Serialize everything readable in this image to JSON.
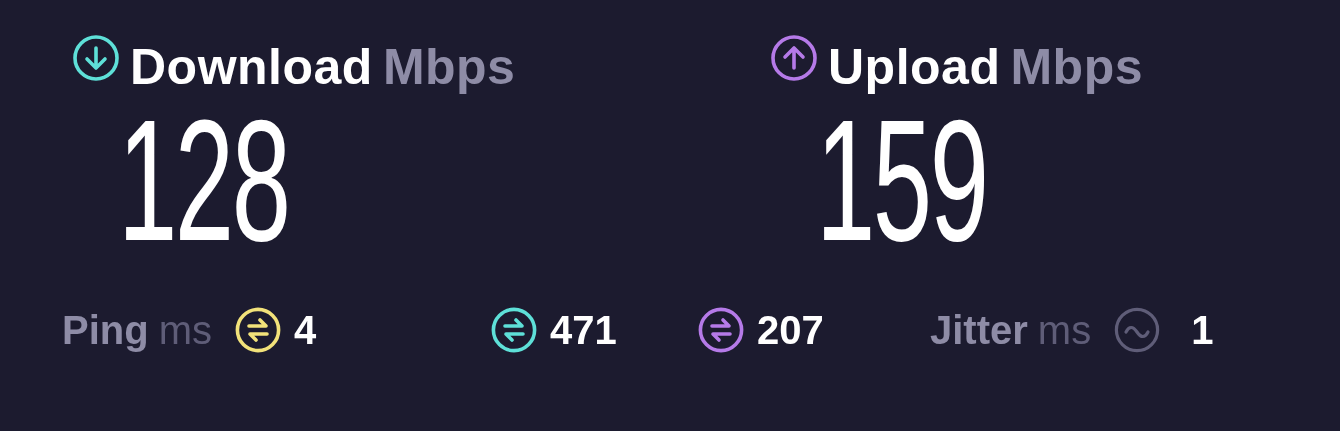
{
  "speeds": [
    {
      "kind": "download",
      "label": "Download",
      "unit": "Mbps",
      "value": "128",
      "color": "#5ee0d8"
    },
    {
      "kind": "upload",
      "label": "Upload",
      "unit": "Mbps",
      "value": "159",
      "color": "#b57ae8"
    }
  ],
  "stats": [
    {
      "kind": "ping",
      "label": "Ping",
      "unit": "ms",
      "color": "#f2e27a",
      "value": "4"
    },
    {
      "kind": "latency",
      "color": "#5ee0d8",
      "value": "471"
    },
    {
      "kind": "latency",
      "color": "#b57ae8",
      "value": "207"
    },
    {
      "kind": "jitter",
      "label": "Jitter",
      "unit": "ms",
      "value": "1"
    }
  ]
}
